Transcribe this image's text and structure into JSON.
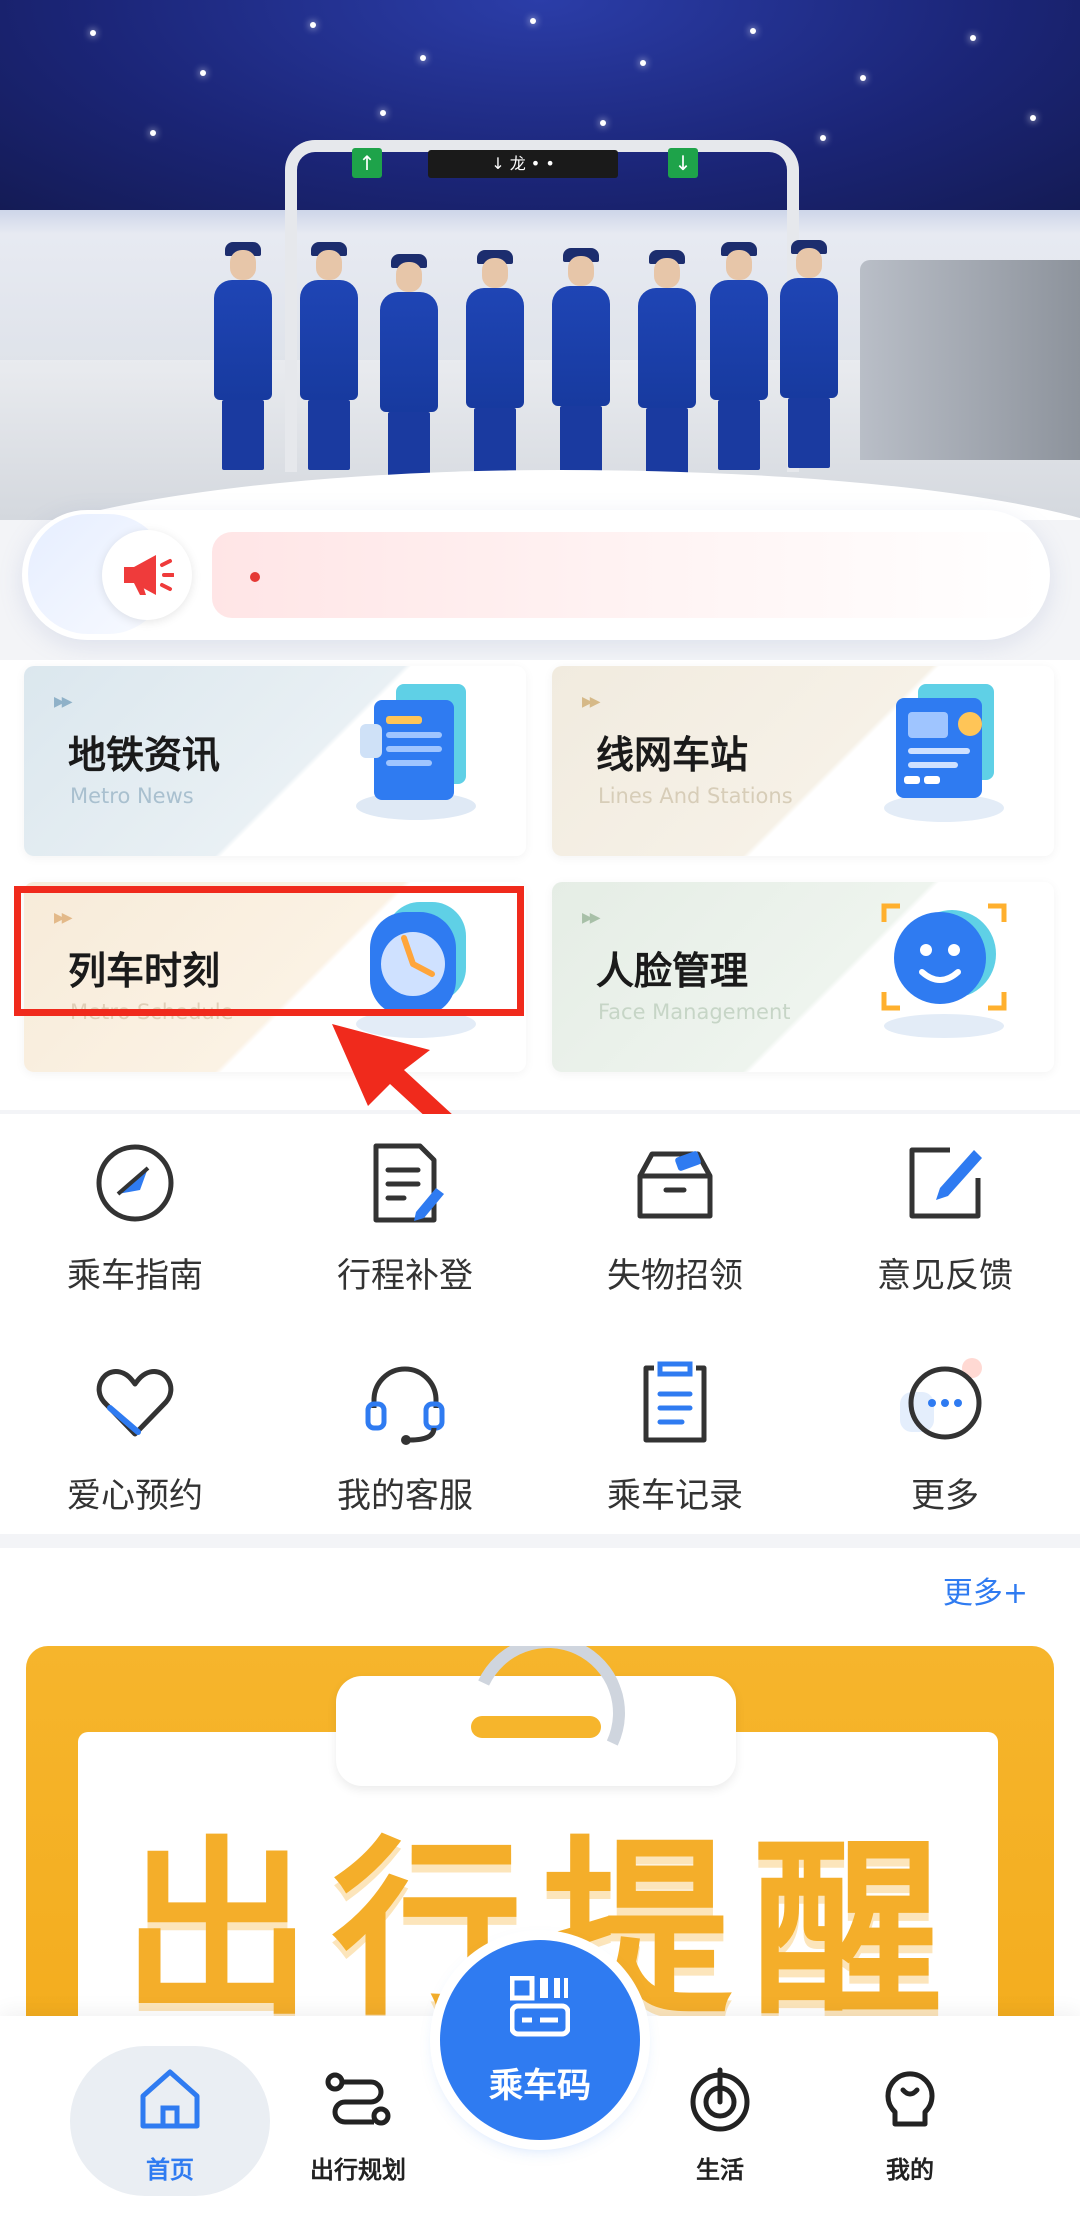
{
  "hero": {
    "sign_text": "↓ 龙 • •"
  },
  "notice": {
    "text": ""
  },
  "cards": [
    {
      "title": "地铁资讯",
      "subtitle": "Metro News"
    },
    {
      "title": "线网车站",
      "subtitle": "Lines And Stations"
    },
    {
      "title": "列车时刻",
      "subtitle": "Metro Schedule"
    },
    {
      "title": "人脸管理",
      "subtitle": "Face Management"
    }
  ],
  "grid": [
    {
      "label": "乘车指南",
      "icon": "compass-icon"
    },
    {
      "label": "行程补登",
      "icon": "document-edit-icon"
    },
    {
      "label": "失物招领",
      "icon": "lost-found-box-icon"
    },
    {
      "label": "意见反馈",
      "icon": "feedback-edit-icon"
    },
    {
      "label": "爱心预约",
      "icon": "heart-icon"
    },
    {
      "label": "我的客服",
      "icon": "headset-icon"
    },
    {
      "label": "乘车记录",
      "icon": "clipboard-list-icon"
    },
    {
      "label": "更多",
      "icon": "more-dots-icon"
    }
  ],
  "reminder": {
    "more_label": "更多+",
    "poster_text": "出行提醒"
  },
  "nav": {
    "home": "首页",
    "plan": "出行规划",
    "ride_code": "乘车码",
    "life": "生活",
    "mine": "我的"
  },
  "colors": {
    "accent": "#2f7bf1",
    "highlight": "#f02a1c",
    "poster": "#f6b52c"
  }
}
